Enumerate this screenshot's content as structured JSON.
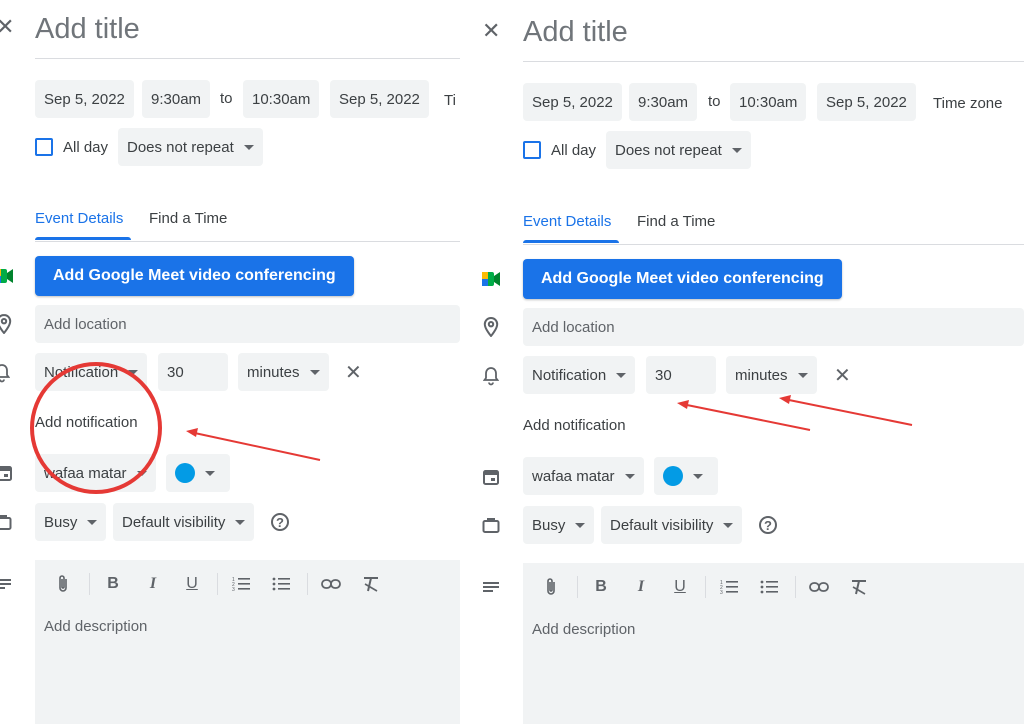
{
  "panels": [
    {
      "title_placeholder": "Add title",
      "start_date": "Sep 5, 2022",
      "start_time": "9:30am",
      "to_label": "to",
      "end_time": "10:30am",
      "end_date": "Sep 5, 2022",
      "timezone_label": "Ti",
      "all_day_label": "All day",
      "repeat_label": "Does not repeat",
      "tabs": [
        "Event Details",
        "Find a Time"
      ],
      "meet_button": "Add Google Meet video conferencing",
      "location_placeholder": "Add location",
      "notification_type": "Notification",
      "notification_value": "30",
      "notification_unit": "minutes",
      "add_notification": "Add notification",
      "calendar_owner": "wafaa matar",
      "busy_label": "Busy",
      "visibility_label": "Default visibility",
      "description_placeholder": "Add description"
    },
    {
      "title_placeholder": "Add title",
      "start_date": "Sep 5, 2022",
      "start_time": "9:30am",
      "to_label": "to",
      "end_time": "10:30am",
      "end_date": "Sep 5, 2022",
      "timezone_label": "Time zone",
      "all_day_label": "All day",
      "repeat_label": "Does not repeat",
      "tabs": [
        "Event Details",
        "Find a Time"
      ],
      "meet_button": "Add Google Meet video conferencing",
      "location_placeholder": "Add location",
      "notification_type": "Notification",
      "notification_value": "30",
      "notification_unit": "minutes",
      "add_notification": "Add notification",
      "calendar_owner": "wafaa matar",
      "busy_label": "Busy",
      "visibility_label": "Default visibility",
      "description_placeholder": "Add description"
    }
  ],
  "icons": {
    "close": "close-icon",
    "meet": "google-meet-icon",
    "location": "location-pin-icon",
    "notification": "bell-icon",
    "calendar": "calendar-icon",
    "busy": "briefcase-icon",
    "description": "notes-icon",
    "help": "help-icon"
  },
  "toolbar": [
    "attach-icon",
    "bold-icon",
    "italic-icon",
    "underline-icon",
    "numbered-list-icon",
    "bulleted-list-icon",
    "link-icon",
    "clear-formatting-icon"
  ],
  "toolbar_glyphs": {
    "bold": "B",
    "italic": "I",
    "underline": "U"
  },
  "colors": {
    "accent": "#1a73e8",
    "calendar_color": "#039be5",
    "annotation": "#e53935"
  },
  "annotations": {
    "left": [
      "circle",
      "arrow"
    ],
    "right": [
      "arrow",
      "arrow"
    ]
  }
}
